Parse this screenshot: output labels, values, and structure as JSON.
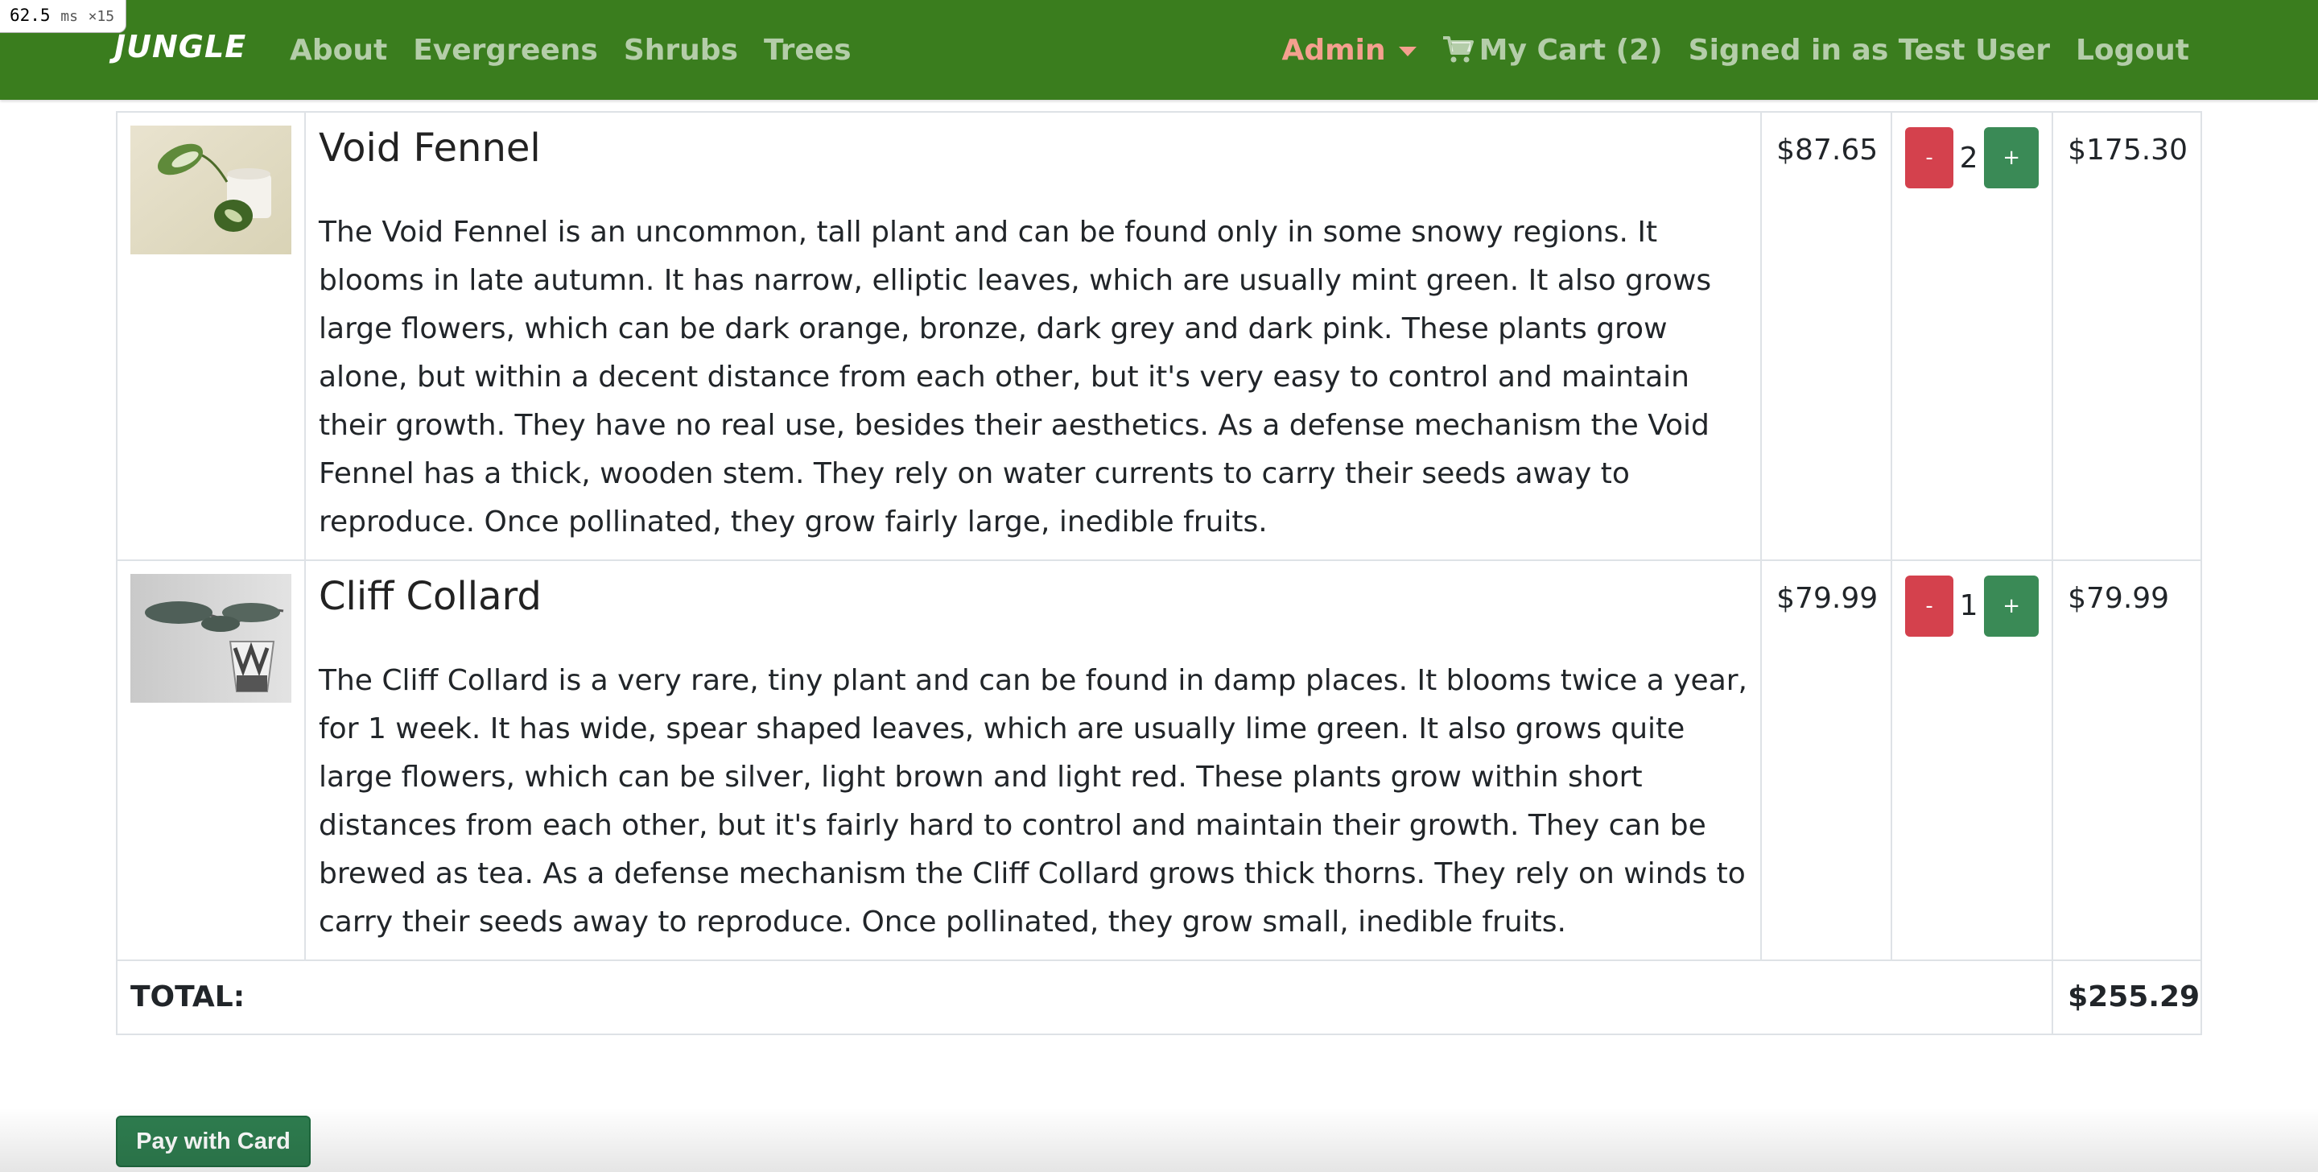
{
  "perf": {
    "value": "62.5",
    "unit": "ms",
    "multiplier": "×15"
  },
  "nav": {
    "brand": "JUNGLE",
    "links": [
      "About",
      "Evergreens",
      "Shrubs",
      "Trees"
    ],
    "admin": "Admin",
    "cart": "My Cart (2)",
    "signed_in": "Signed in as Test User",
    "logout": "Logout"
  },
  "cart": {
    "items": [
      {
        "name": "Void Fennel",
        "description": "The Void Fennel is an uncommon, tall plant and can be found only in some snowy regions. It blooms in late autumn. It has narrow, elliptic leaves, which are usually mint green. It also grows large flowers, which can be dark orange, bronze, dark grey and dark pink. These plants grow alone, but within a decent distance from each other, but it's very easy to control and maintain their growth. They have no real use, besides their aesthetics. As a defense mechanism the Void Fennel has a thick, wooden stem. They rely on water currents to carry their seeds away to reproduce. Once pollinated, they grow fairly large, inedible fruits.",
        "price": "$87.65",
        "quantity": "2",
        "subtotal": "$175.30",
        "minus": "-",
        "plus": "+"
      },
      {
        "name": "Cliff Collard",
        "description": "The Cliff Collard is a very rare, tiny plant and can be found in damp places. It blooms twice a year, for 1 week. It has wide, spear shaped leaves, which are usually lime green. It also grows quite large flowers, which can be silver, light brown and light red. These plants grow within short distances from each other, but it's fairly hard to control and maintain their growth. They can be brewed as tea. As a defense mechanism the Cliff Collard grows thick thorns. They rely on winds to carry their seeds away to reproduce. Once pollinated, they grow small, inedible fruits.",
        "price": "$79.99",
        "quantity": "1",
        "subtotal": "$79.99",
        "minus": "-",
        "plus": "+"
      }
    ],
    "total_label": "TOTAL:",
    "total_value": "$255.29"
  },
  "pay_button": "Pay with Card",
  "colors": {
    "navbar": "#3a7d1e",
    "admin": "#f4a08e",
    "minus_button": "#d4414d",
    "plus_button": "#3a8a56",
    "pay_button": "#2e7d4f"
  },
  "icons": [
    "cart-icon",
    "caret-down-icon"
  ]
}
